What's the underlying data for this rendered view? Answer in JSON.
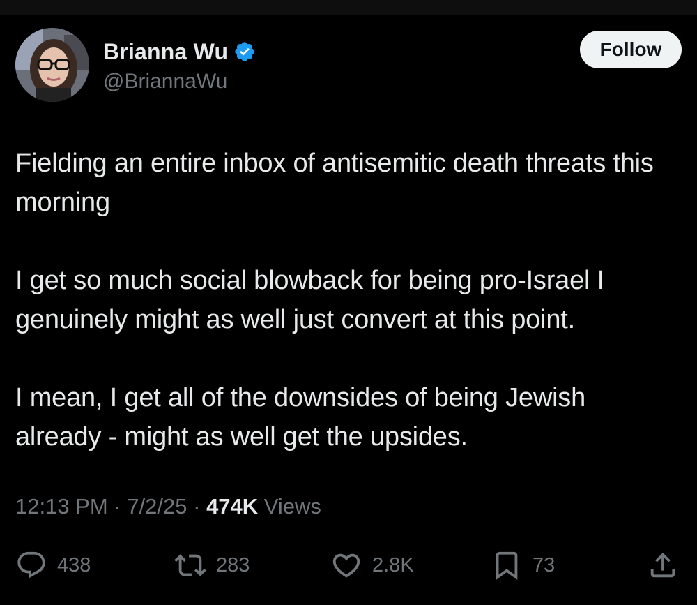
{
  "author": {
    "display_name": "Brianna Wu",
    "handle": "@BriannaWu",
    "verified_icon": "verified-badge-icon",
    "avatar": "avatar-photo"
  },
  "header": {
    "follow_label": "Follow"
  },
  "tweet": {
    "paragraphs": [
      "Fielding an entire inbox of antisemitic death threats this morning",
      "I get so much social blowback for being pro-Israel I genuinely might as well just convert at this point.",
      "I mean, I get all of the downsides of being Jewish already - might as well get the upsides."
    ]
  },
  "meta": {
    "time": "12:13 PM",
    "date": "7/2/25",
    "views_count": "474K",
    "views_label": "Views",
    "separator": "·"
  },
  "actions": {
    "replies": "438",
    "reposts": "283",
    "likes": "2.8K",
    "bookmarks": "73"
  },
  "colors": {
    "background": "#000000",
    "text_primary": "#e7e9ea",
    "text_secondary": "#71767b",
    "verified_blue": "#1d9bf0",
    "follow_bg": "#eff3f4"
  }
}
